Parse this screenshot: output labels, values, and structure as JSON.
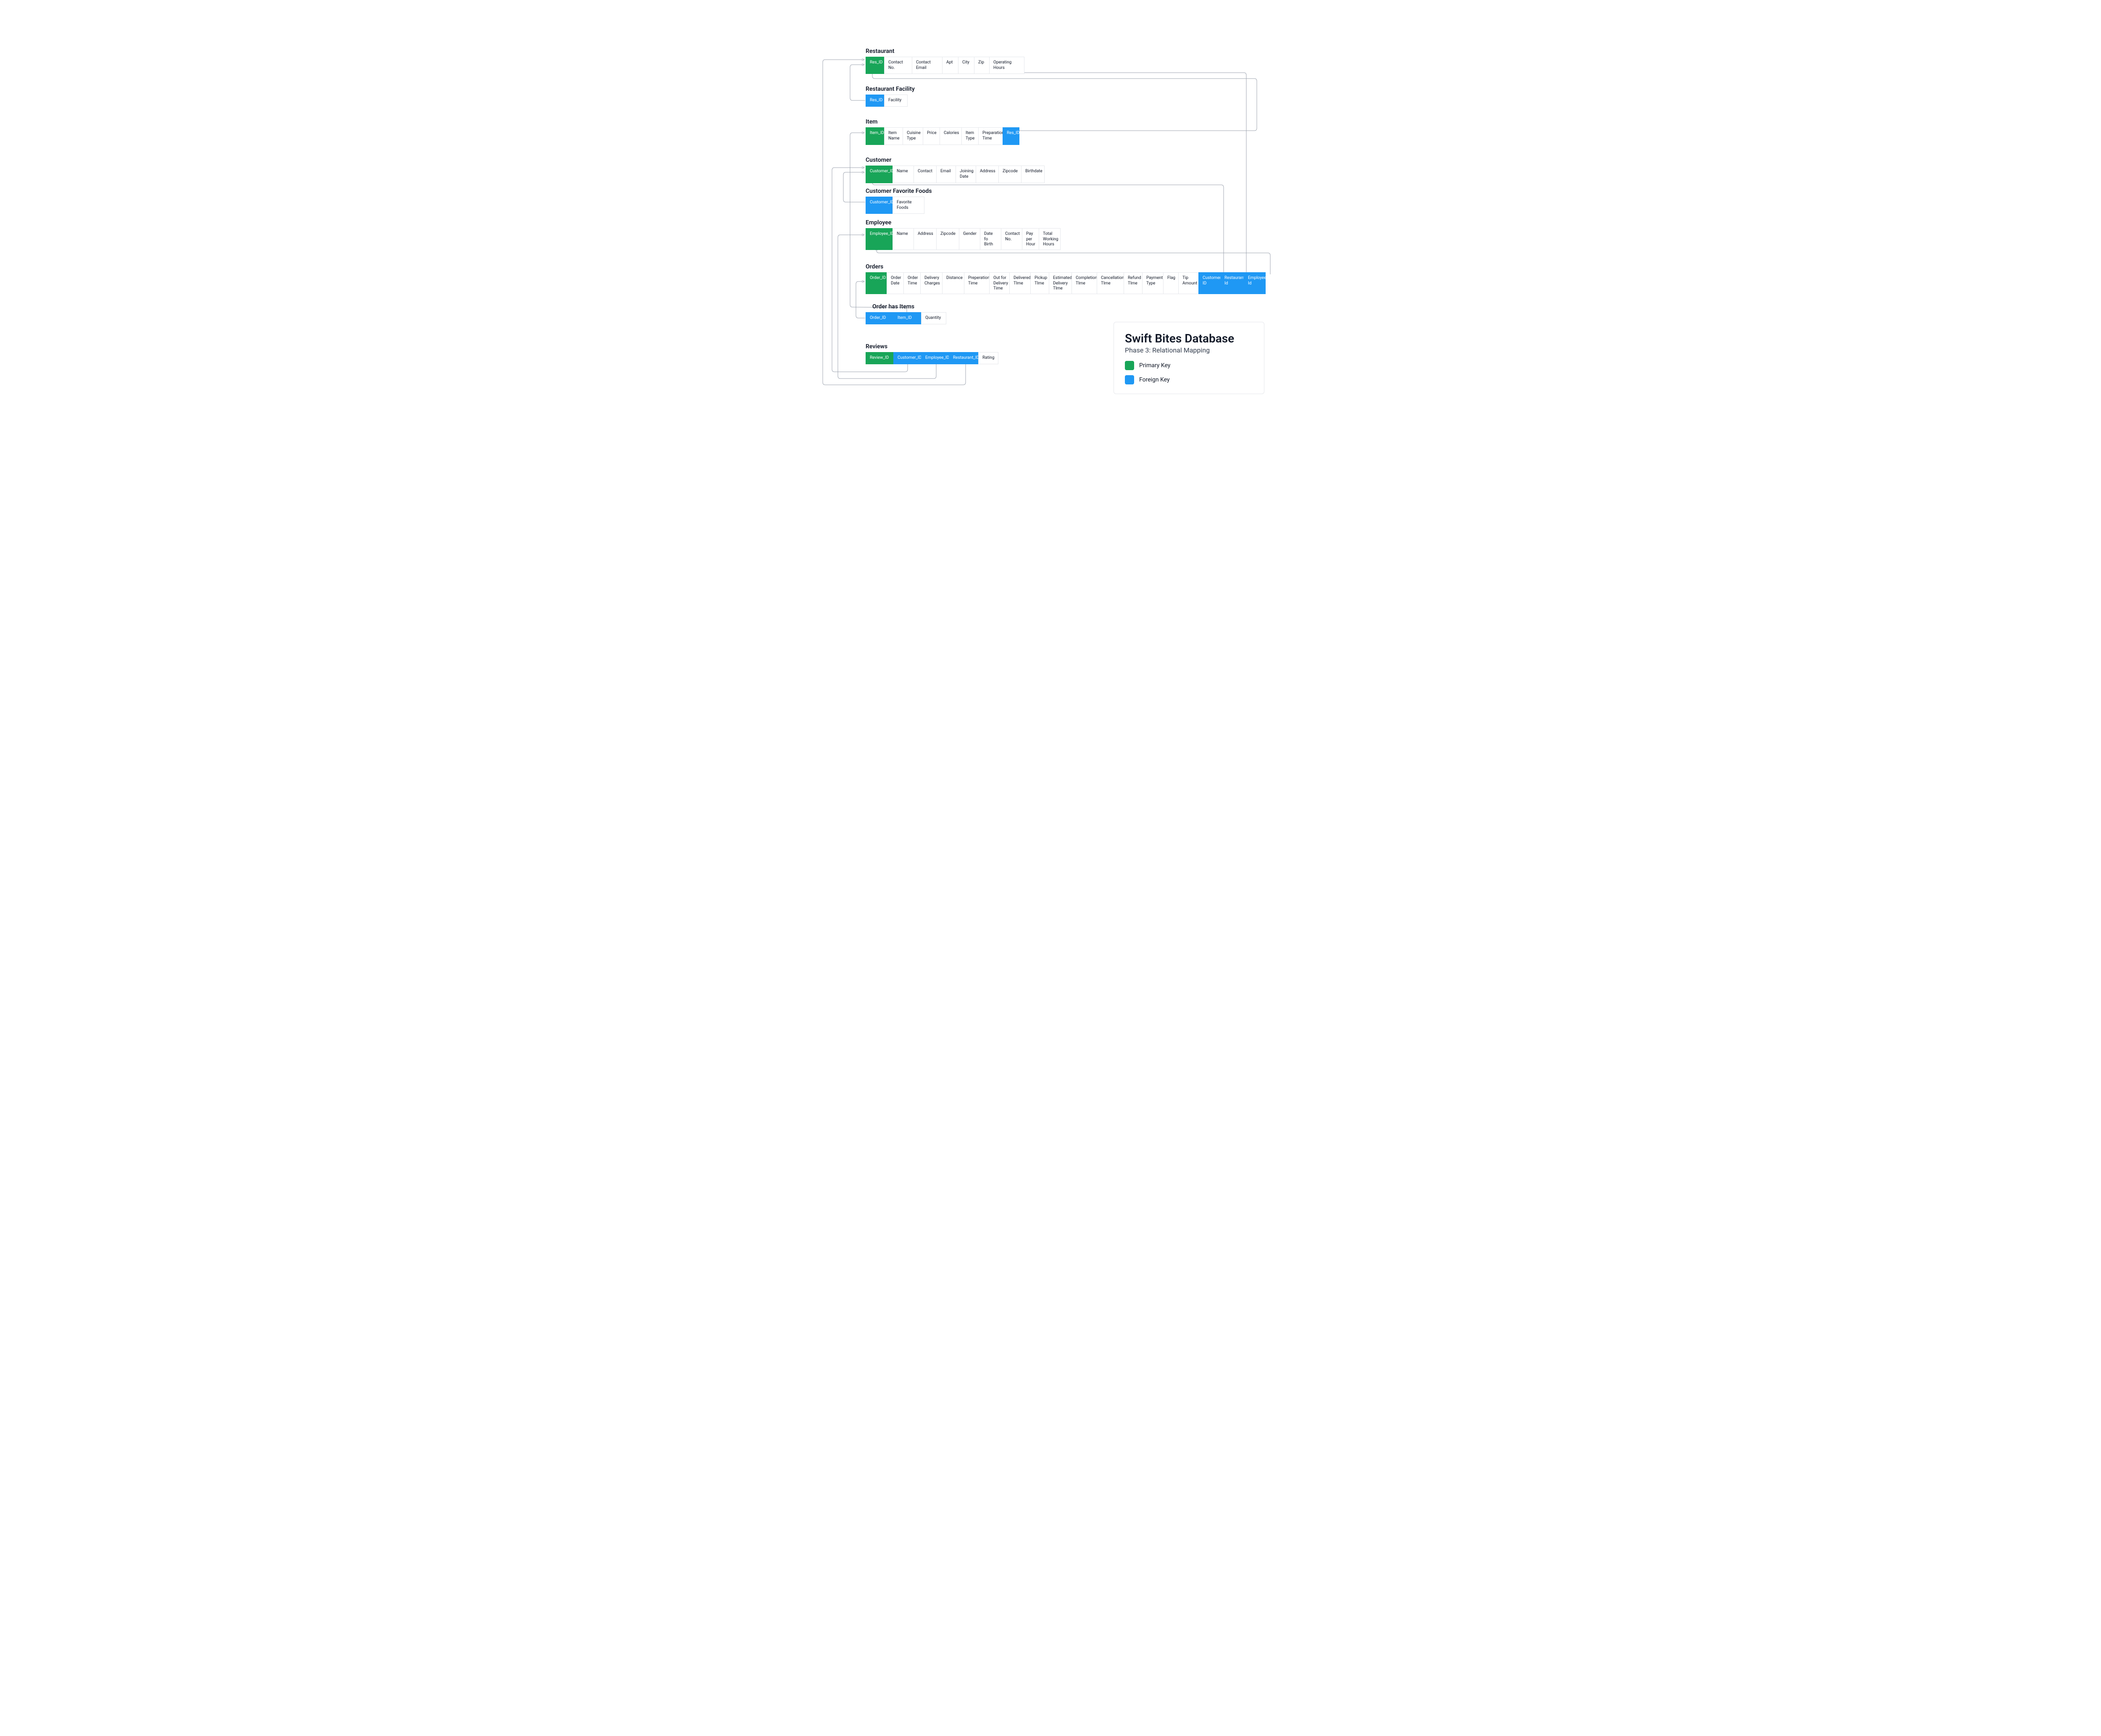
{
  "colors": {
    "pk": "#18A558",
    "fk": "#1F98F4",
    "line": "#9CA3AF"
  },
  "tables": {
    "restaurant": {
      "title": "Restaurant",
      "cols": [
        {
          "label": "Res_ID",
          "type": "pk"
        },
        {
          "label": "Contact No."
        },
        {
          "label": "Contact Email"
        },
        {
          "label": "Apt"
        },
        {
          "label": "City"
        },
        {
          "label": "Zip"
        },
        {
          "label": "Operating Hours"
        }
      ]
    },
    "restaurant_facility": {
      "title": "Restaurant Facility",
      "cols": [
        {
          "label": "Res_ID",
          "type": "fk"
        },
        {
          "label": "Facility"
        }
      ]
    },
    "item": {
      "title": "Item",
      "cols": [
        {
          "label": "Item_ID",
          "type": "pk"
        },
        {
          "label": "Item Name"
        },
        {
          "label": "Cuisine Type"
        },
        {
          "label": "Price"
        },
        {
          "label": "Calories"
        },
        {
          "label": "Item Type"
        },
        {
          "label": "Preparation Time"
        },
        {
          "label": "Res_ID",
          "type": "fk"
        }
      ]
    },
    "customer": {
      "title": "Customer",
      "cols": [
        {
          "label": "Customer_ID",
          "type": "pk"
        },
        {
          "label": "Name"
        },
        {
          "label": "Contact"
        },
        {
          "label": "Email"
        },
        {
          "label": "Joining Date"
        },
        {
          "label": "Address"
        },
        {
          "label": "Zipcode"
        },
        {
          "label": "Birthdate"
        }
      ]
    },
    "customer_favorite_foods": {
      "title": "Customer Favorite Foods",
      "cols": [
        {
          "label": "Customer_ID",
          "type": "fk"
        },
        {
          "label": "Favorite Foods"
        }
      ]
    },
    "employee": {
      "title": "Employee",
      "cols": [
        {
          "label": "Employee_ID",
          "type": "pk"
        },
        {
          "label": "Name"
        },
        {
          "label": "Address"
        },
        {
          "label": "Zipcode"
        },
        {
          "label": "Gender"
        },
        {
          "label": "Date fo Birth"
        },
        {
          "label": "Contact No."
        },
        {
          "label": "Pay per Hour"
        },
        {
          "label": "Total Working Hours"
        }
      ]
    },
    "orders": {
      "title": "Orders",
      "cols": [
        {
          "label": "Order_ID",
          "type": "pk"
        },
        {
          "label": "Order Date"
        },
        {
          "label": "Order Time"
        },
        {
          "label": "Delivery Charges"
        },
        {
          "label": "Distance"
        },
        {
          "label": "Preperation Time"
        },
        {
          "label": "Out for Delivery Time"
        },
        {
          "label": "Delivered TIme"
        },
        {
          "label": "Pickup TIme"
        },
        {
          "label": "Estimated Delivery TIme"
        },
        {
          "label": "Completion TIme"
        },
        {
          "label": "Cancellation TIme"
        },
        {
          "label": "Refund TIme"
        },
        {
          "label": "Payment Type"
        },
        {
          "label": "Flag"
        },
        {
          "label": "Tip Amount"
        },
        {
          "label": "Customer ID",
          "type": "fk"
        },
        {
          "label": "Restaurant Id",
          "type": "fk"
        },
        {
          "label": "Employee Id",
          "type": "fk"
        }
      ]
    },
    "order_has_items": {
      "title": "Order has Items",
      "cols": [
        {
          "label": "Order_ID",
          "type": "fk"
        },
        {
          "label": "Item_ID",
          "type": "fk"
        },
        {
          "label": "Quantity"
        }
      ]
    },
    "reviews": {
      "title": "Reviews",
      "cols": [
        {
          "label": "Review_ID",
          "type": "pk"
        },
        {
          "label": "Customer_ID",
          "type": "fk"
        },
        {
          "label": "Employee_ID",
          "type": "fk"
        },
        {
          "label": "Restaurant_ID",
          "type": "fk"
        },
        {
          "label": "Rating"
        }
      ]
    }
  },
  "legend": {
    "title": "Swift Bites Database",
    "subtitle": "Phase 3: Relational Mapping",
    "pk_label": "Primary Key",
    "fk_label": "Foreign Key"
  }
}
